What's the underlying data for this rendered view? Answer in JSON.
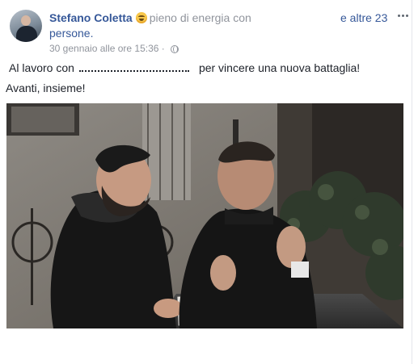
{
  "post": {
    "author": "Stefano Coletta",
    "feeling_text": "pieno di energia con",
    "others_link": "e altre 23",
    "people_text": "persone.",
    "timestamp": "30 gennaio alle ore 15:36",
    "separator": "·",
    "text_line1_start": "Al lavoro con",
    "text_line1_end": "per vincere una nuova battaglia!",
    "text_line2": "Avanti, insieme!"
  },
  "icons": {
    "feeling": "grinning-face-emoji",
    "privacy": "globe-icon",
    "options": "more-horizontal-icon"
  },
  "colors": {
    "link": "#365899",
    "meta": "#90949c",
    "text": "#1d2129"
  }
}
